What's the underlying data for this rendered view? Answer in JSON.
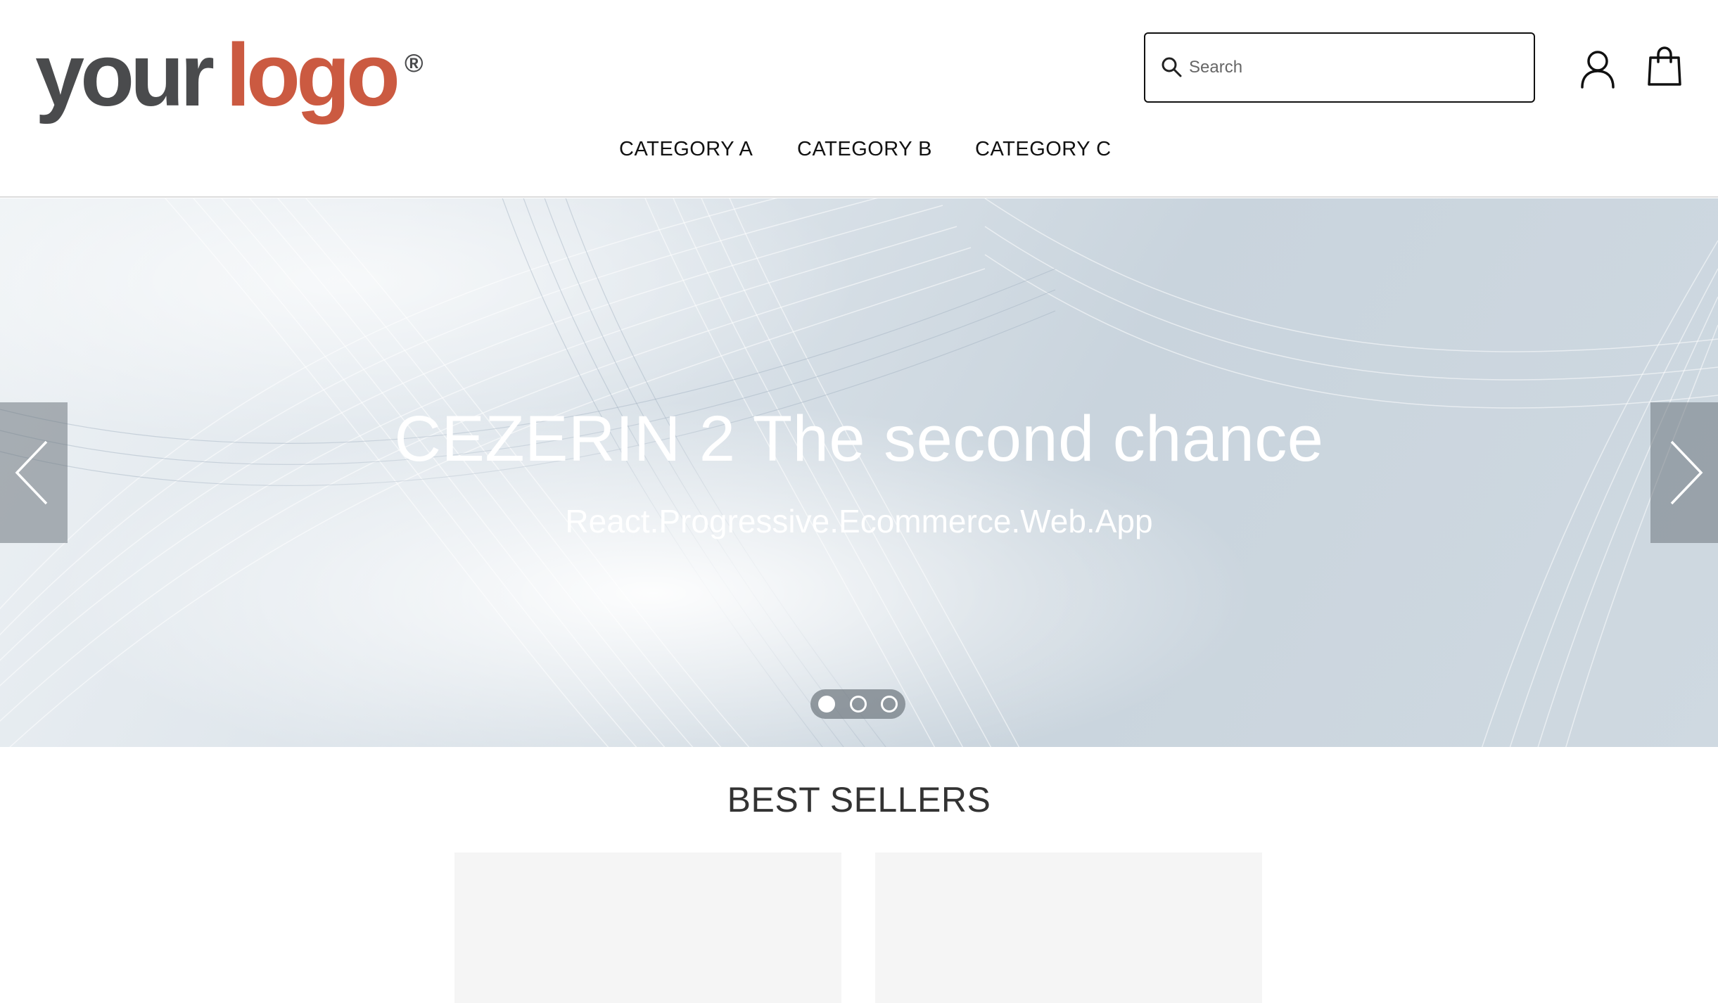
{
  "header": {
    "logo": {
      "word1": "your",
      "word2": "logo",
      "registered": "®",
      "color_primary": "#4a4b4d",
      "color_accent": "#cb5a41"
    },
    "search": {
      "placeholder": "Search",
      "value": "",
      "icon": "search-icon"
    },
    "account_icon": "user-icon",
    "cart_icon": "shopping-bag-icon"
  },
  "nav": {
    "items": [
      {
        "label": "CATEGORY A"
      },
      {
        "label": "CATEGORY B"
      },
      {
        "label": "CATEGORY C"
      }
    ]
  },
  "hero": {
    "title": "CEZERIN 2 The second chance",
    "subtitle": "React.Progressive.Ecommerce.Web.App",
    "prev_icon": "chevron-left-icon",
    "next_icon": "chevron-right-icon",
    "slides": 3,
    "active_slide": 1
  },
  "best_sellers": {
    "title": "BEST SELLERS"
  }
}
